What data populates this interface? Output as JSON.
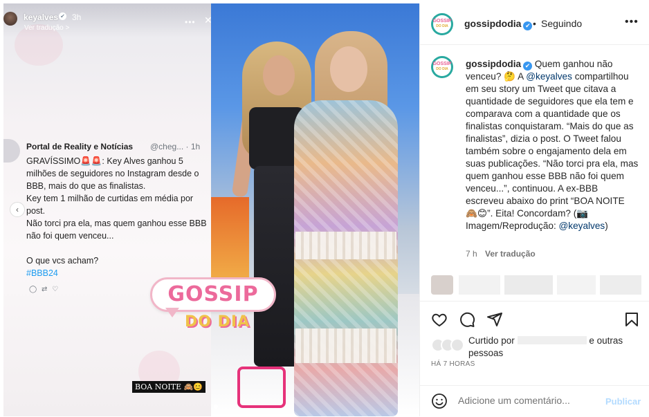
{
  "story": {
    "username": "keyalves",
    "time": "3h",
    "translate": "Ver tradução >",
    "caption": "BOA NOITE 🙈😊"
  },
  "tweet": {
    "name": "Portal de Reality e Notícias",
    "handle": "@cheg... · 1h",
    "body": "GRAVÍSSIMO🚨🚨: Key Alves ganhou 5 milhões de seguidores no Instagram desde o BBB, mais do que as finalistas.\nKey tem 1 milhão de curtidas em média por post.\nNão torci pra ela, mas quem ganhou esse BBB não foi quem venceu...\n\nO que vcs acham?",
    "hashtag": "#BBB24"
  },
  "logo": {
    "top": "GOSSIP",
    "bottom": "DO DIA"
  },
  "avatar": {
    "line1": "GOSSIP",
    "line2": "DO DIA"
  },
  "header": {
    "username": "gossipdodia",
    "separator": "•",
    "follow_status": "Seguindo",
    "more": "•••"
  },
  "caption": {
    "username": "gossipdodia",
    "part1": "Quem ganhou não venceu? 🤔 A ",
    "mention1": "@keyalves",
    "part2": " compartilhou em seu story um Tweet que citava a quantidade de seguidores que ela tem e comparava com a quantidade que os finalistas conquistaram. “Mais do que as finalistas”, dizia o post. O Tweet falou também sobre o engajamento dela em suas publicações. “Não torci pra ela, mas quem ganhou esse BBB não foi quem venceu...”, continuou. A ex-BBB escreveu abaixo do print “BOA NOITE 🙈😊”. Eita! Concordam? (📷 Imagem/Reprodução: ",
    "mention2": "@keyalves",
    "part3": ")",
    "time": "7 h",
    "translate": "Ver tradução"
  },
  "likes": {
    "prefix": "Curtido por",
    "suffix": "e outras pessoas",
    "ago": "HÁ 7 HORAS"
  },
  "comment": {
    "placeholder": "Adicione um comentário...",
    "publish": "Publicar"
  },
  "icons": [
    "heart-icon",
    "comment-icon",
    "share-icon",
    "bookmark-icon",
    "emoji-icon",
    "verified-icon",
    "more-icon",
    "chevron-left-icon"
  ],
  "colors": {
    "accent": "#3897f0",
    "mention": "#00376b",
    "publish_disabled": "#b3dbff",
    "brand_pink": "#ec6a9b",
    "brand_teal": "#29a9a0"
  }
}
